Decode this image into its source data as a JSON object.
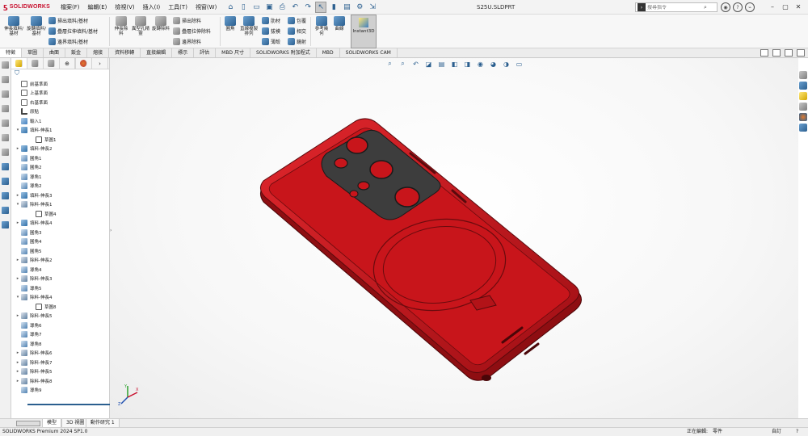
{
  "app": {
    "brand": "SOLIDWORKS",
    "doc_title": "S25U.SLDPRT"
  },
  "menu": [
    "檔案(F)",
    "編輯(E)",
    "檢視(V)",
    "插入(I)",
    "工具(T)",
    "視窗(W)"
  ],
  "search": {
    "placeholder": "搜尋指令"
  },
  "ribbon": {
    "extrude_boss": "伸長填料/基材",
    "revolve_boss": "旋轉填料/基材",
    "swept_boss": "掃出填料/基材",
    "lofted_boss": "疊層拉伸填料/基材",
    "boundary_boss": "邊界填料/基材",
    "extrude_cut": "伸長除料",
    "hole_wizard": "異型孔精靈",
    "revolve_cut": "旋轉除料",
    "swept_cut": "掃出除料",
    "lofted_cut": "疊層拉伸除料",
    "boundary_cut": "邊界除料",
    "fillet": "圓角",
    "linear_pattern": "直線複製排列",
    "rib": "肋材",
    "wrap": "包覆",
    "draft": "拔模",
    "intersect": "相交",
    "shell": "薄殼",
    "mirror": "鏡射",
    "ref_geometry": "參考幾何",
    "curves": "曲線",
    "instant3d": "Instant3D"
  },
  "cmd_tabs": [
    "特徵",
    "草圖",
    "曲面",
    "鈑金",
    "熔接",
    "資料移轉",
    "直接編輯",
    "標示",
    "評估",
    "MBD 尺寸",
    "SOLIDWORKS 附加程式",
    "MBD",
    "SOLIDWORKS CAM"
  ],
  "feature_tree": [
    {
      "label": "前基準面",
      "icon": "plane-icon",
      "arrow": ""
    },
    {
      "label": "上基準面",
      "icon": "plane-icon",
      "arrow": ""
    },
    {
      "label": "右基準面",
      "icon": "plane-icon",
      "arrow": ""
    },
    {
      "label": "原點",
      "icon": "origin-icon",
      "arrow": ""
    },
    {
      "label": "輸入1",
      "icon": "input-icon",
      "arrow": ""
    },
    {
      "label": "填料-伸長1",
      "icon": "boss-icon",
      "arrow": "▾"
    },
    {
      "label": "草圖1",
      "icon": "sketch-icon",
      "arrow": "",
      "indent": true
    },
    {
      "label": "填料-伸長2",
      "icon": "boss-icon",
      "arrow": "▸"
    },
    {
      "label": "圓角1",
      "icon": "fillet-icon",
      "arrow": ""
    },
    {
      "label": "圓角2",
      "icon": "fillet-icon",
      "arrow": ""
    },
    {
      "label": "導角1",
      "icon": "fillet-icon",
      "arrow": ""
    },
    {
      "label": "導角2",
      "icon": "fillet-icon",
      "arrow": ""
    },
    {
      "label": "填料-伸長3",
      "icon": "boss-icon",
      "arrow": "▸"
    },
    {
      "label": "除料-伸長1",
      "icon": "cut-icon",
      "arrow": "▾"
    },
    {
      "label": "草圖4",
      "icon": "sketch-icon",
      "arrow": "",
      "indent": true
    },
    {
      "label": "填料-伸長4",
      "icon": "boss-icon",
      "arrow": "▸"
    },
    {
      "label": "圓角3",
      "icon": "fillet-icon",
      "arrow": ""
    },
    {
      "label": "圓角4",
      "icon": "fillet-icon",
      "arrow": ""
    },
    {
      "label": "圓角5",
      "icon": "fillet-icon",
      "arrow": ""
    },
    {
      "label": "除料-伸長2",
      "icon": "cut-icon",
      "arrow": "▸"
    },
    {
      "label": "導角4",
      "icon": "fillet-icon",
      "arrow": ""
    },
    {
      "label": "除料-伸長3",
      "icon": "cut-icon",
      "arrow": "▸"
    },
    {
      "label": "導角5",
      "icon": "fillet-icon",
      "arrow": ""
    },
    {
      "label": "除料-伸長4",
      "icon": "cut-icon",
      "arrow": "▾"
    },
    {
      "label": "草圖8",
      "icon": "sketch-icon",
      "arrow": "",
      "indent": true
    },
    {
      "label": "除料-伸長5",
      "icon": "cut-icon",
      "arrow": "▸"
    },
    {
      "label": "導角6",
      "icon": "fillet-icon",
      "arrow": ""
    },
    {
      "label": "導角7",
      "icon": "fillet-icon",
      "arrow": ""
    },
    {
      "label": "導角8",
      "icon": "fillet-icon",
      "arrow": ""
    },
    {
      "label": "除料-伸長6",
      "icon": "cut-icon",
      "arrow": "▸"
    },
    {
      "label": "除料-伸長7",
      "icon": "cut-icon",
      "arrow": "▸"
    },
    {
      "label": "除料-伸長5",
      "icon": "cut-icon",
      "arrow": "▸"
    },
    {
      "label": "除料-伸長8",
      "icon": "cut-icon",
      "arrow": "▸"
    },
    {
      "label": "導角9",
      "icon": "fillet-icon",
      "arrow": ""
    }
  ],
  "bottom_tabs": [
    "模型",
    "3D 視圖",
    "動作研究 1"
  ],
  "status": {
    "version": "SOLIDWORKS Premium 2024 SP1.0",
    "editing": "正在編輯:",
    "part": "零件",
    "units": "自訂"
  },
  "colors": {
    "part_red": "#c8151b",
    "part_red_dark": "#8e0e12",
    "camera_plate": "#3d3d3d",
    "brand_red": "#c8102e"
  }
}
